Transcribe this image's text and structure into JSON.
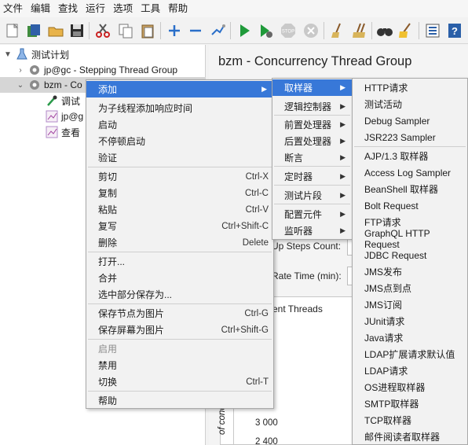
{
  "menubar": [
    "文件",
    "编辑",
    "查找",
    "运行",
    "选项",
    "工具",
    "帮助"
  ],
  "toolbar_icons": [
    "new-icon",
    "templates-icon",
    "open-icon",
    "save-icon",
    "cut-icon",
    "copy-icon",
    "paste-icon",
    "expand-icon",
    "collapse-icon",
    "toggle-icon",
    "start-icon",
    "start-no-pause-icon",
    "stop-icon",
    "shutdown-icon",
    "clear-icon",
    "clear-all-icon",
    "search-icon",
    "reset-search-icon",
    "function-helper-icon",
    "help-icon"
  ],
  "tree": {
    "root": "测试计划",
    "n1": "jp@gc - Stepping Thread Group",
    "n2": "bzm - Co",
    "n3": "调试",
    "n4": "jp@g",
    "n5": "查看"
  },
  "right": {
    "title": "bzm - Concurrency Thread Group",
    "steps_label": "Up Steps Count:",
    "rate_label": "Rate Time (min):",
    "threads_label": "ent Threads",
    "y_axis_label": "of concur",
    "ticks": [
      "3 000",
      "2 400"
    ]
  },
  "context_menu": {
    "items": [
      {
        "label": "添加",
        "accel": "",
        "submenu": true,
        "highlight": true
      },
      {
        "label": "为子线程添加响应时间",
        "accel": ""
      },
      {
        "label": "启动",
        "accel": ""
      },
      {
        "label": "不停顿启动",
        "accel": ""
      },
      {
        "label": "验证",
        "accel": ""
      },
      {
        "label": "剪切",
        "accel": "Ctrl-X"
      },
      {
        "label": "复制",
        "accel": "Ctrl-C"
      },
      {
        "label": "粘贴",
        "accel": "Ctrl-V"
      },
      {
        "label": "复写",
        "accel": "Ctrl+Shift-C"
      },
      {
        "label": "删除",
        "accel": "Delete"
      },
      {
        "label": "打开...",
        "accel": ""
      },
      {
        "label": "合并",
        "accel": ""
      },
      {
        "label": "选中部分保存为...",
        "accel": ""
      },
      {
        "label": "保存节点为图片",
        "accel": "Ctrl-G"
      },
      {
        "label": "保存屏幕为图片",
        "accel": "Ctrl+Shift-G"
      },
      {
        "label": "启用",
        "accel": "",
        "disabled": true
      },
      {
        "label": "禁用",
        "accel": ""
      },
      {
        "label": "切换",
        "accel": "Ctrl-T"
      },
      {
        "label": "帮助",
        "accel": ""
      }
    ]
  },
  "add_submenu": {
    "items": [
      {
        "label": "取样器",
        "highlight": true
      },
      {
        "label": "逻辑控制器"
      },
      {
        "label": "前置处理器"
      },
      {
        "label": "后置处理器"
      },
      {
        "label": "断言"
      },
      {
        "label": "定时器"
      },
      {
        "label": "测试片段"
      },
      {
        "label": "配置元件"
      },
      {
        "label": "监听器"
      }
    ]
  },
  "sampler_submenu": {
    "items": [
      "HTTP请求",
      "测试活动",
      "Debug Sampler",
      "JSR223 Sampler",
      "AJP/1.3 取样器",
      "Access Log Sampler",
      "BeanShell 取样器",
      "Bolt Request",
      "FTP请求",
      "GraphQL HTTP Request",
      "JDBC Request",
      "JMS发布",
      "JMS点到点",
      "JMS订阅",
      "JUnit请求",
      "Java请求",
      "LDAP扩展请求默认值",
      "LDAP请求",
      "OS进程取样器",
      "SMTP取样器",
      "TCP取样器",
      "邮件阅读者取样器"
    ]
  },
  "colors": {
    "highlight": "#3878d8",
    "menu_bg": "#f2f2f2"
  }
}
